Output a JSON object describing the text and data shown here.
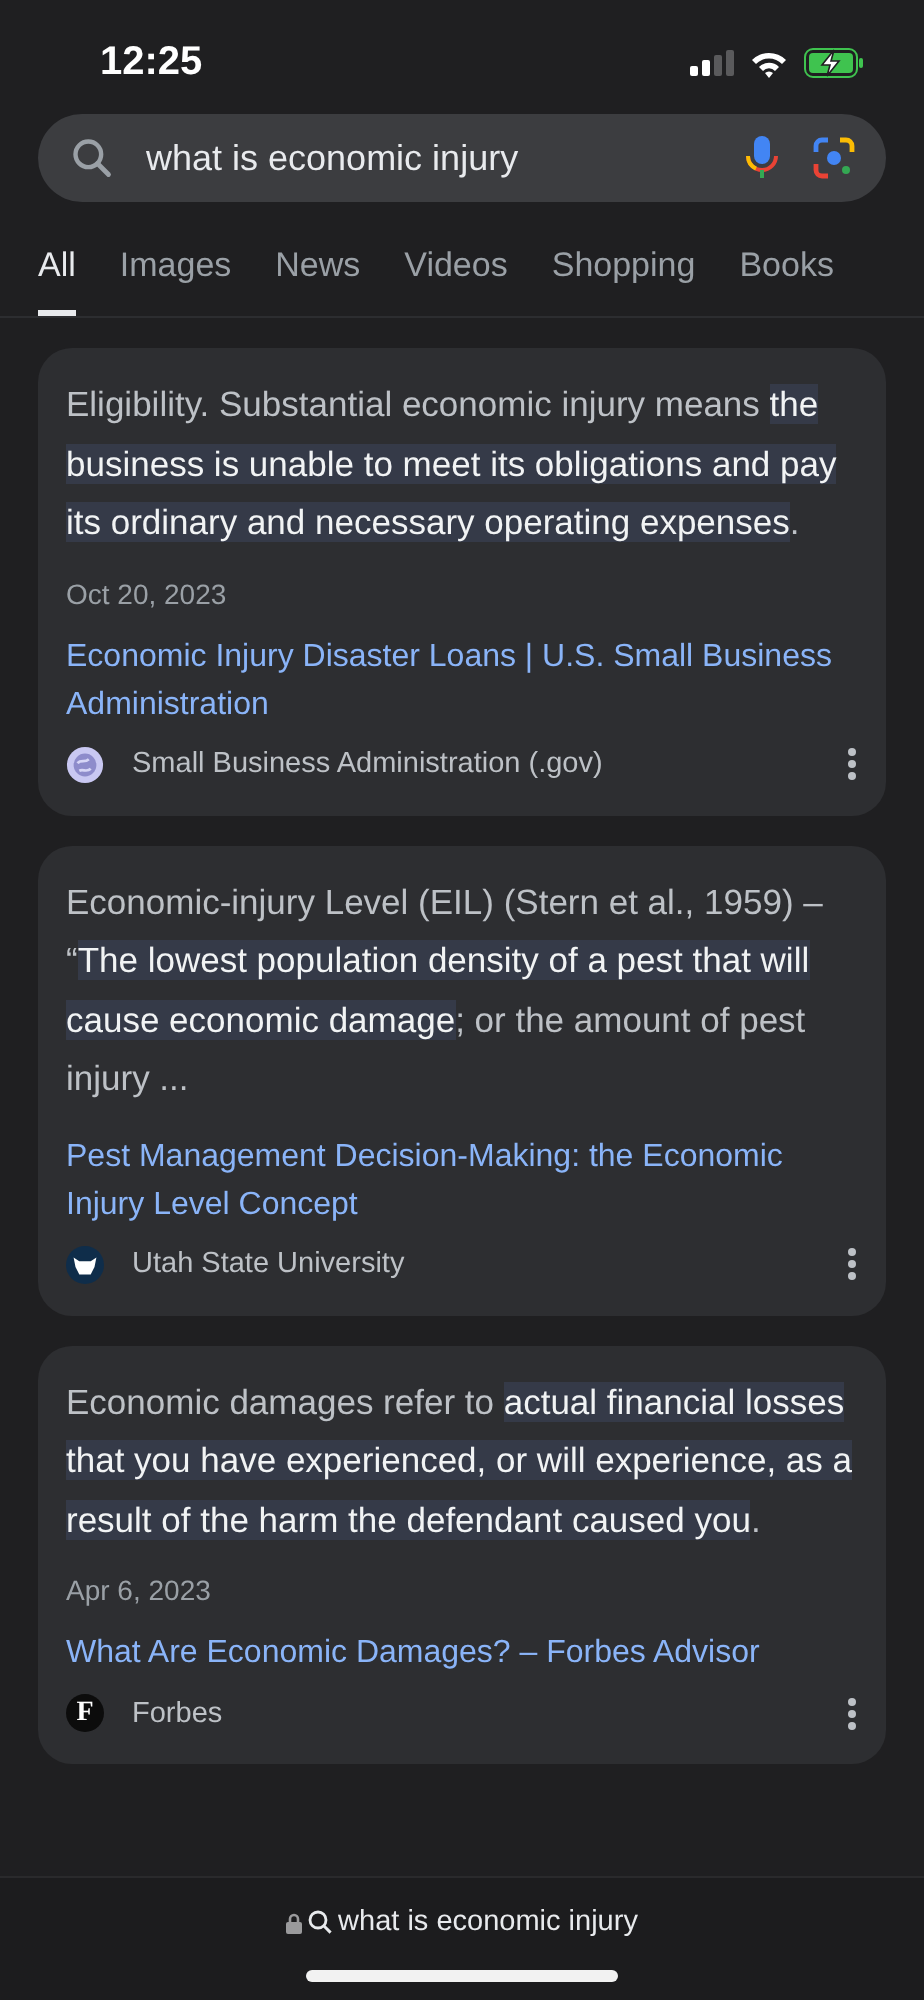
{
  "status_bar": {
    "time": "12:25"
  },
  "search": {
    "value": "what is economic injury"
  },
  "tabs": [
    {
      "label": "All",
      "selected": true
    },
    {
      "label": "Images",
      "selected": false
    },
    {
      "label": "News",
      "selected": false
    },
    {
      "label": "Videos",
      "selected": false
    },
    {
      "label": "Shopping",
      "selected": false
    },
    {
      "label": "Books",
      "selected": false
    }
  ],
  "results": [
    {
      "snippet": "Eligibility. Substantial economic injury means **the business is unable to meet its obligations and pay its ordinary and necessary operating expenses**.",
      "date": "Oct 20, 2023",
      "title": "Economic Injury Disaster Loans | U.S. Small Business Administration",
      "source": "Small Business Administration (.gov)",
      "source_icon": {
        "kind": "globe"
      }
    },
    {
      "snippet": "Economic-injury Level (EIL) (Stern et al., 1959) – “**The lowest population density of a pest that will cause economic damage**; or the amount of pest injury ...",
      "title": "Pest Management Decision-Making: the Economic Injury Level Concept",
      "source": "Utah State University",
      "source_icon": {
        "kind": "mascot"
      }
    },
    {
      "snippet": "Economic damages refer to **actual financial losses that you have experienced, or will experience, as a result of the harm the defendant caused you**.",
      "date": "Apr 6, 2023",
      "title": "What Are Economic Damages? – Forbes Advisor",
      "source": "Forbes",
      "source_icon": {
        "kind": "letter",
        "text": "F"
      }
    }
  ],
  "address_bar": {
    "url": "what is economic injury"
  }
}
